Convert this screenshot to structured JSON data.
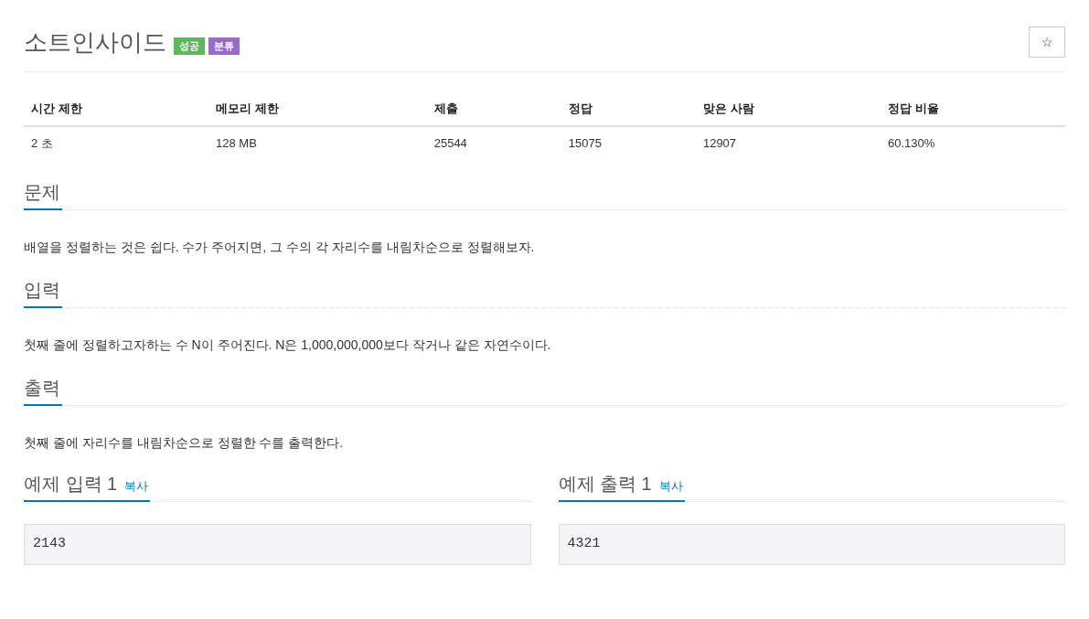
{
  "title": "소트인사이드",
  "badges": [
    {
      "label": "성공",
      "color": "#5cb85c"
    },
    {
      "label": "분류",
      "color": "#9b6bcc"
    }
  ],
  "star_button": "☆",
  "table": {
    "columns": [
      "시간 제한",
      "메모리 제한",
      "제출",
      "정답",
      "맞은 사람",
      "정답 비율"
    ],
    "rows": [
      [
        "2 초",
        "128 MB",
        "25544",
        "15075",
        "12907",
        "60.130%"
      ]
    ]
  },
  "sections": [
    {
      "heading": "문제",
      "text": "배열을 정렬하는 것은 쉽다. 수가 주어지면, 그 수의 각 자리수를 내림차순으로 정렬해보자."
    },
    {
      "heading": "입력",
      "text": "첫째 줄에 정렬하고자하는 수 N이 주어진다. N은 1,000,000,000보다 작거나 같은 자연수이다."
    },
    {
      "heading": "출력",
      "text": "첫째 줄에 자리수를 내림차순으로 정렬한 수를 출력한다."
    }
  ],
  "samples": [
    {
      "heading": "예제 입력 1",
      "copy": "복사",
      "value": "2143"
    },
    {
      "heading": "예제 출력 1",
      "copy": "복사",
      "value": "4321"
    }
  ]
}
